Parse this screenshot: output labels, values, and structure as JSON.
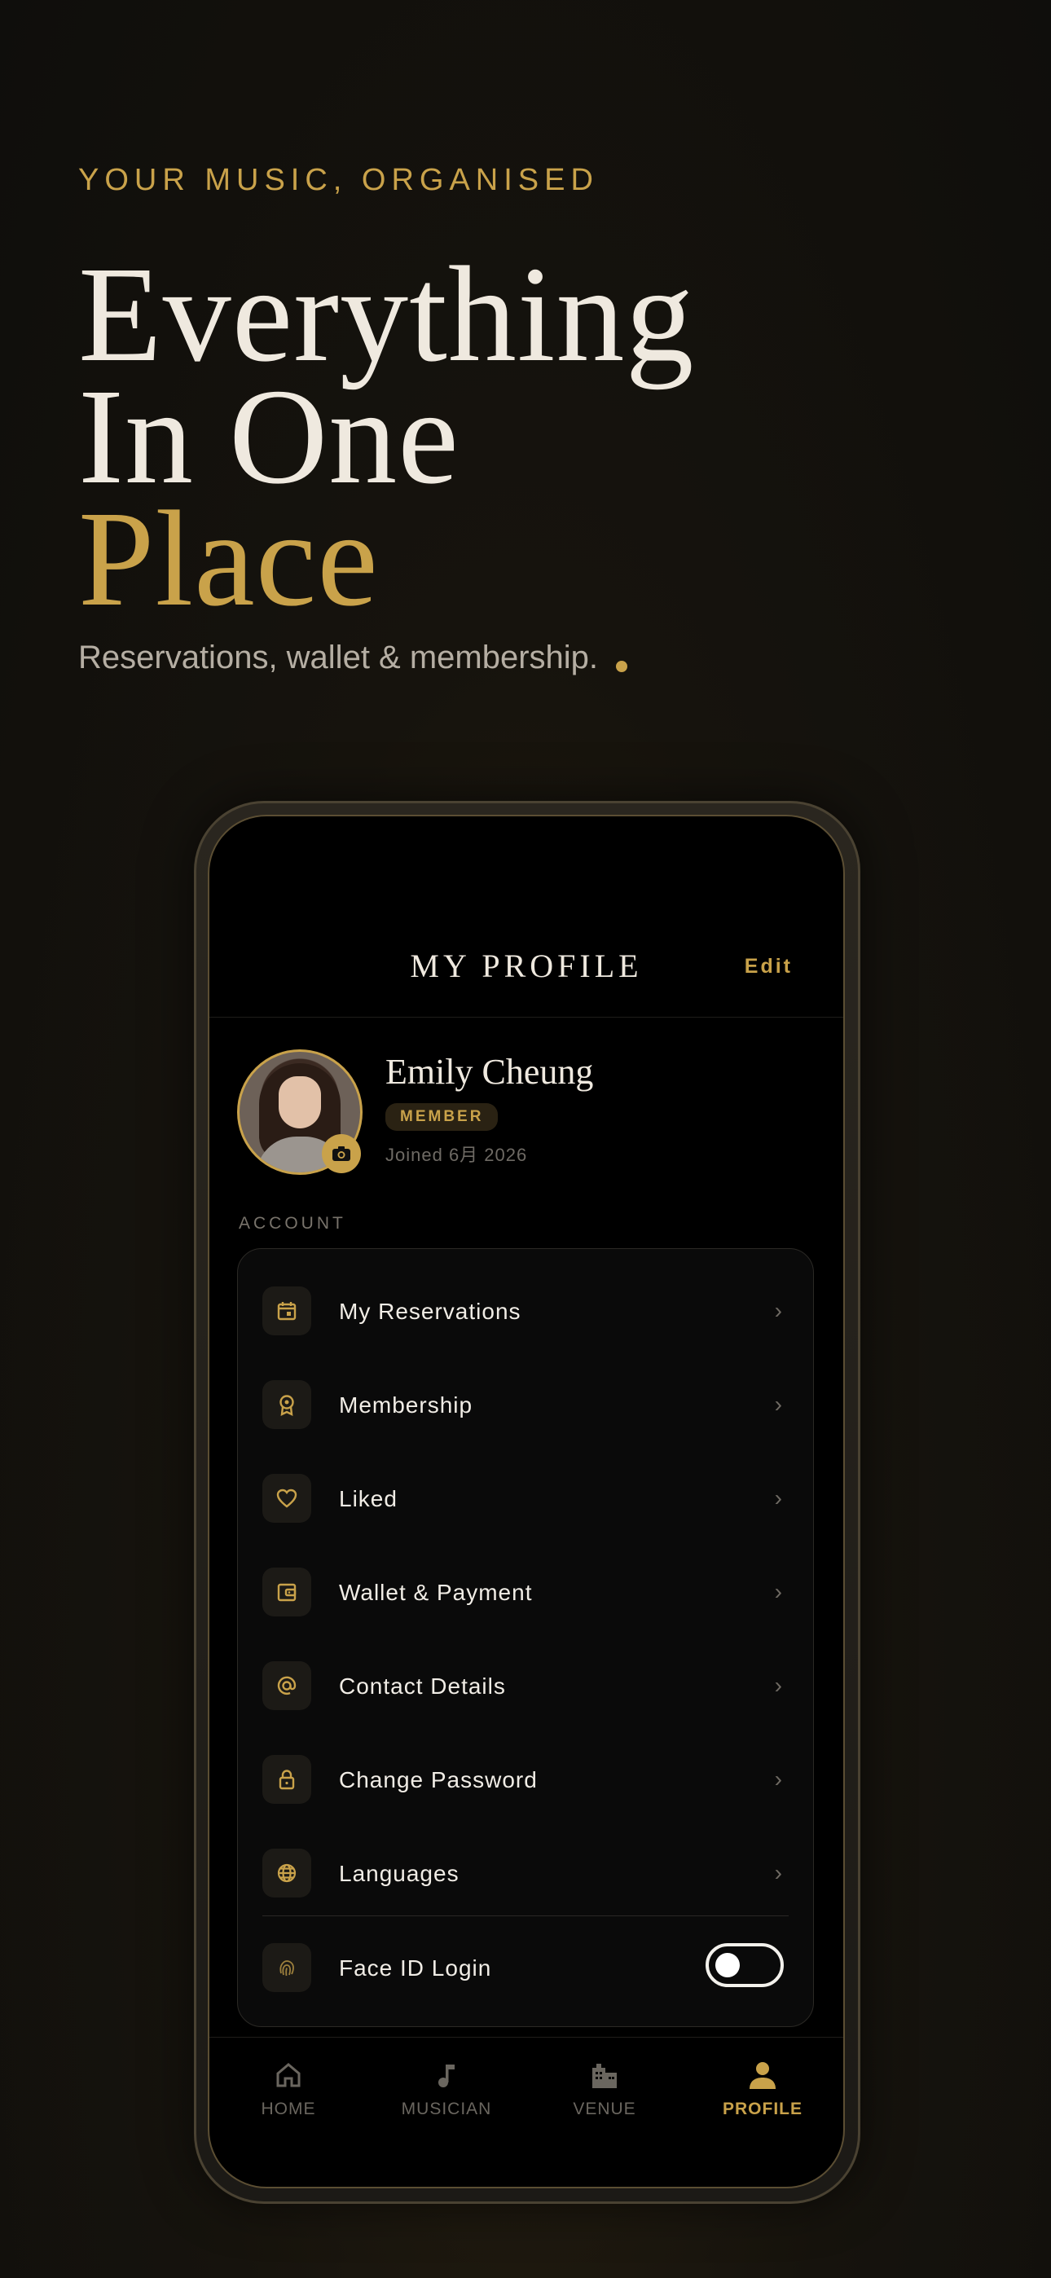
{
  "hero": {
    "eyebrow": "YOUR MUSIC, ORGANISED",
    "headline_line1": "Everything",
    "headline_line2": "In One",
    "headline_line3": "Place",
    "subline": "Reservations, wallet & membership."
  },
  "header": {
    "title": "MY PROFILE",
    "edit_label": "Edit"
  },
  "profile": {
    "name": "Emily Cheung",
    "badge": "MEMBER",
    "joined": "Joined 6月 2026"
  },
  "account": {
    "section_label": "ACCOUNT",
    "items": [
      {
        "label": "My Reservations",
        "icon": "calendar-icon"
      },
      {
        "label": "Membership",
        "icon": "award-icon"
      },
      {
        "label": "Liked",
        "icon": "heart-icon"
      },
      {
        "label": "Wallet & Payment",
        "icon": "wallet-icon"
      },
      {
        "label": "Contact Details",
        "icon": "at-sign-icon"
      },
      {
        "label": "Change Password",
        "icon": "lock-icon"
      },
      {
        "label": "Languages",
        "icon": "globe-icon"
      }
    ],
    "face_id": {
      "label": "Face ID Login",
      "icon": "fingerprint-icon",
      "enabled": false
    }
  },
  "tabs": [
    {
      "label": "HOME",
      "icon": "home-icon",
      "active": false
    },
    {
      "label": "MUSICIAN",
      "icon": "music-note-icon",
      "active": false
    },
    {
      "label": "VENUE",
      "icon": "building-icon",
      "active": false
    },
    {
      "label": "PROFILE",
      "icon": "person-icon",
      "active": true
    }
  ],
  "colors": {
    "accent": "#c9a24a",
    "background": "#000000",
    "text": "#efe9df"
  }
}
